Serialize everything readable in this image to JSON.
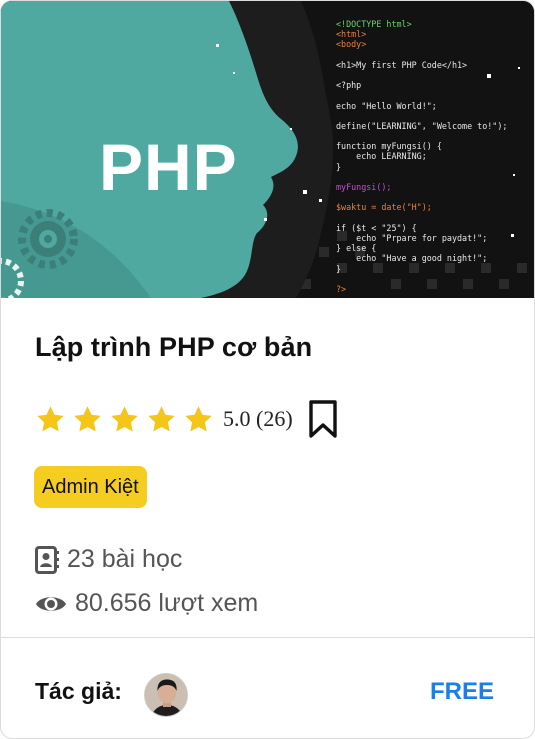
{
  "course": {
    "thumbnail": {
      "logo_text": "PHP",
      "code_lines": [
        {
          "text": "<!DOCTYPE html>",
          "color": "#6fd06f"
        },
        {
          "text": "<html>",
          "color": "#e8823a"
        },
        {
          "text": "<body>",
          "color": "#e8823a"
        },
        {
          "text": "",
          "color": "#e8e8e8"
        },
        {
          "text": "<h1>My first PHP Code</h1>",
          "color": "#e8e8e8"
        },
        {
          "text": "",
          "color": "#e8e8e8"
        },
        {
          "text": "<?php",
          "color": "#e8e8e8"
        },
        {
          "text": "",
          "color": "#e8e8e8"
        },
        {
          "text": "echo \"Hello World!\";",
          "color": "#e8e8e8"
        },
        {
          "text": "",
          "color": "#e8e8e8"
        },
        {
          "text": "define(\"LEARNING\", \"Welcome to!\");",
          "color": "#e8e8e8"
        },
        {
          "text": "",
          "color": "#e8e8e8"
        },
        {
          "text": "function myFungsi() {",
          "color": "#e8e8e8"
        },
        {
          "text": "    echo LEARNING;",
          "color": "#e8e8e8"
        },
        {
          "text": "}",
          "color": "#e8e8e8"
        },
        {
          "text": "",
          "color": "#e8e8e8"
        },
        {
          "text": "myFungsi();",
          "color": "#c74fd1"
        },
        {
          "text": "",
          "color": "#e8e8e8"
        },
        {
          "text": "$waktu = date(\"H\");",
          "color": "#e8823a"
        },
        {
          "text": "",
          "color": "#e8e8e8"
        },
        {
          "text": "if ($t < \"25\") {",
          "color": "#e8e8e8"
        },
        {
          "text": "    echo \"Prpare for paydat!\";",
          "color": "#e8e8e8"
        },
        {
          "text": "} else {",
          "color": "#e8e8e8"
        },
        {
          "text": "    echo \"Have a good night!\";",
          "color": "#e8e8e8"
        },
        {
          "text": "}",
          "color": "#e8e8e8"
        },
        {
          "text": "",
          "color": "#e8e8e8"
        },
        {
          "text": "?>",
          "color": "#e8823a"
        }
      ]
    },
    "title": "Lập trình PHP cơ bản",
    "rating": {
      "value": 5.0,
      "max": 5,
      "text": "5.0 (26)",
      "star_color": "#f5c518"
    },
    "tag": "Admin Kiệt",
    "lessons": {
      "icon": "contact-book-icon",
      "text": "23 bài học"
    },
    "views": {
      "icon": "eye-icon",
      "text": "80.656 lượt xem"
    },
    "author_label": "Tác giả:",
    "price": "FREE",
    "colors": {
      "accent": "#1a7fe6",
      "tag_bg": "#f5cc20",
      "teal": "#4fa9a0"
    }
  }
}
